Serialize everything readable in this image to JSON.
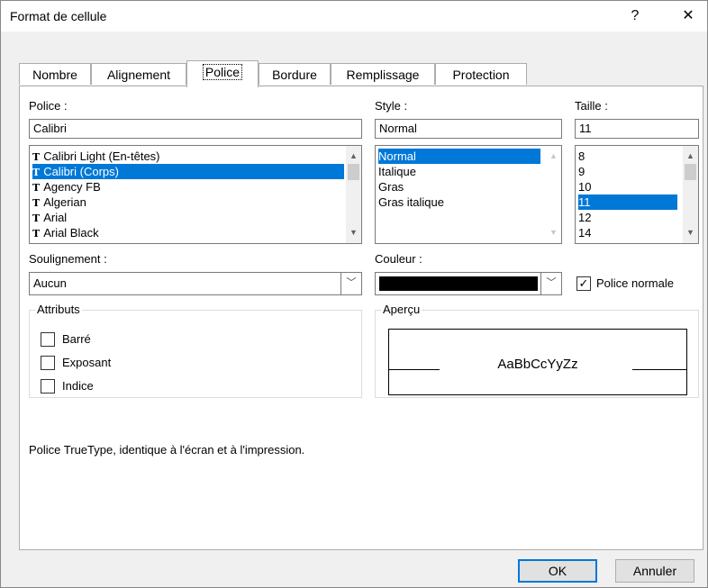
{
  "window": {
    "title": "Format de cellule",
    "help": "?",
    "close": "✕"
  },
  "tabs": [
    {
      "label": "Nombre"
    },
    {
      "label": "Alignement"
    },
    {
      "label": "Police"
    },
    {
      "label": "Bordure"
    },
    {
      "label": "Remplissage"
    },
    {
      "label": "Protection"
    }
  ],
  "font": {
    "label": "Police :",
    "value": "Calibri",
    "items": [
      "Calibri Light (En-têtes)",
      "Calibri (Corps)",
      "Agency FB",
      "Algerian",
      "Arial",
      "Arial Black"
    ],
    "selected_index": 1
  },
  "style": {
    "label": "Style :",
    "value": "Normal",
    "items": [
      "Normal",
      "Italique",
      "Gras",
      "Gras italique"
    ],
    "selected_index": 0
  },
  "size": {
    "label": "Taille :",
    "value": "11",
    "items": [
      "8",
      "9",
      "10",
      "11",
      "12",
      "14"
    ],
    "selected_index": 3
  },
  "underline": {
    "label": "Soulignement :",
    "value": "Aucun"
  },
  "color": {
    "label": "Couleur :",
    "value_color": "#000000"
  },
  "normal_font": {
    "label": "Police normale",
    "checked": true
  },
  "attributes": {
    "title": "Attributs",
    "items": [
      {
        "label": "Barré",
        "checked": false
      },
      {
        "label": "Exposant",
        "checked": false
      },
      {
        "label": "Indice",
        "checked": false
      }
    ]
  },
  "preview": {
    "title": "Aperçu",
    "sample": "AaBbCcYyZz"
  },
  "description": "Police TrueType, identique à l'écran et à l'impression.",
  "buttons": {
    "ok": "OK",
    "cancel": "Annuler"
  },
  "colors": {
    "accent": "#0078d7"
  }
}
